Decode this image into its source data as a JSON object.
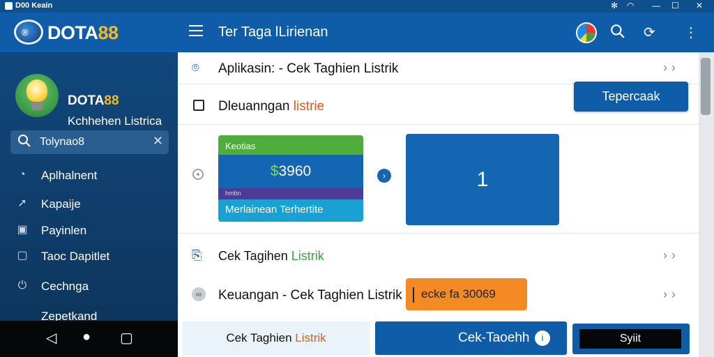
{
  "status_bar": {
    "app_name": "D00 Keain"
  },
  "brand": {
    "badge_text": "®",
    "name_prefix": "DOTA",
    "name_suffix": "88"
  },
  "profile": {
    "title_prefix": "DOTA",
    "title_suffix": "88",
    "subtitle": "Kchhehen Listrica"
  },
  "search": {
    "value": "Tolynao8",
    "clear_icon": "✕"
  },
  "sidebar": {
    "items": [
      {
        "label": "Aplhalnent",
        "icon": "clock-icon"
      },
      {
        "label": "Kapaije",
        "icon": "arrow-icon"
      },
      {
        "label": "Payinlen",
        "icon": "square-icon"
      },
      {
        "label": "Taoc Dapitlet",
        "icon": "square-icon"
      },
      {
        "label": "Cechnga",
        "icon": "power-icon"
      },
      {
        "label": "Zepetkand",
        "icon": "none"
      }
    ]
  },
  "appbar": {
    "title": "Ter Taga lLirienan"
  },
  "content": {
    "row1_label": "Aplikasin: - Cek Taghien Listrik",
    "row2_label_main": "Dleuanngan ",
    "row2_label_accent": "listrie",
    "primary_button": "Tepercaak",
    "card_left": {
      "top": "Keotias",
      "amount_accent": "$",
      "amount": "3960",
      "stripe": "hmbn",
      "bottom": "Merlainean Terhertite"
    },
    "card_right_value": "1",
    "row3_label_main": "Cek Tagihen ",
    "row3_label_accent": "Listrik",
    "row4_label": "Keuangan - Cek Taghien Listrik",
    "orange_button": "ecke fa 30069",
    "bottom": {
      "tab_main": "Cek Taghien ",
      "tab_accent": "Listrik",
      "action_label": "Cek-Taoehh",
      "action_icon": "i",
      "save_label": "Syiit"
    }
  },
  "colors": {
    "primary": "#0f5ca8",
    "accent_orange": "#f48a24",
    "accent_green": "#4fae3b",
    "brand_gold": "#f7b81b"
  }
}
